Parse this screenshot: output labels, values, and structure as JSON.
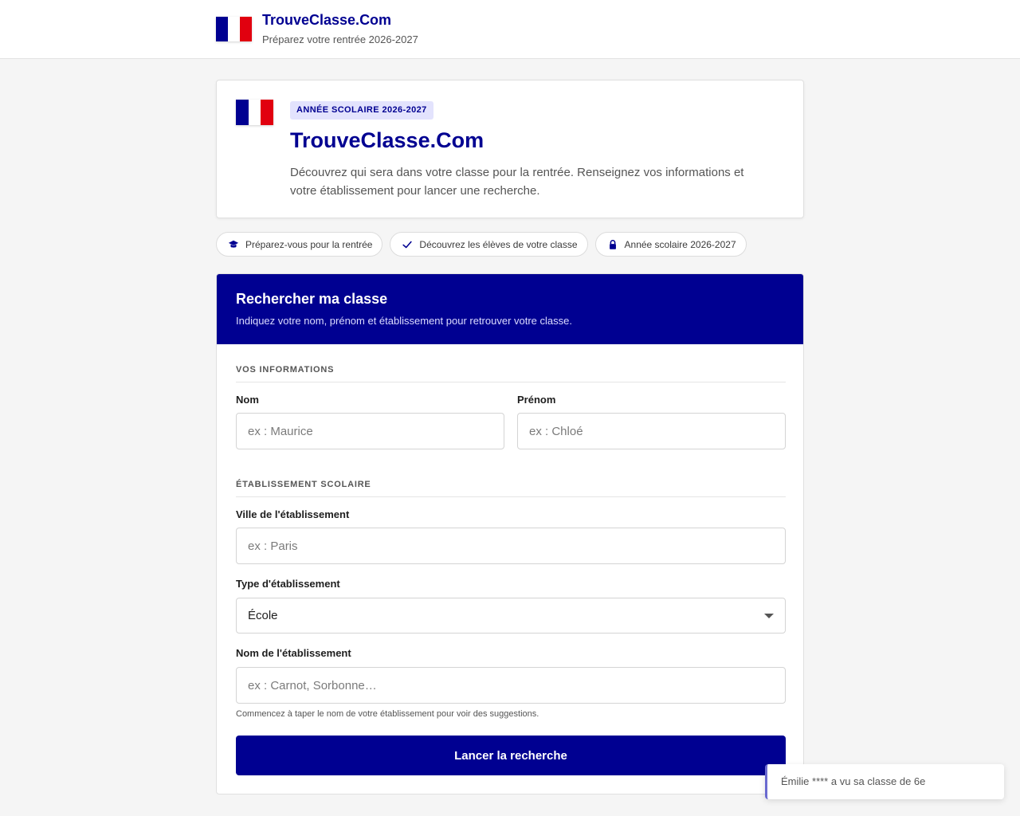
{
  "colors": {
    "primary": "#000091",
    "flag_blue": "#000091",
    "flag_red": "#e1000f",
    "badge_bg": "#e3e3fd"
  },
  "header": {
    "brand_name": "TrouveClasse.Com",
    "tagline": "Préparez votre rentrée 2026-2027"
  },
  "hero": {
    "badge": "ANNÉE SCOLAIRE 2026-2027",
    "title": "TrouveClasse.Com",
    "description": "Découvrez qui sera dans votre classe pour la rentrée. Renseignez vos informations et votre établissement pour lancer une recherche."
  },
  "pills": [
    {
      "icon": "graduation-cap-icon",
      "label": "Préparez-vous pour la rentrée"
    },
    {
      "icon": "check-icon",
      "label": "Découvrez les élèves de votre classe"
    },
    {
      "icon": "lock-icon",
      "label": "Année scolaire 2026-2027"
    }
  ],
  "search": {
    "title": "Rechercher ma classe",
    "subtitle": "Indiquez votre nom, prénom et établissement pour retrouver votre classe.",
    "section_info": "VOS INFORMATIONS",
    "nom": {
      "label": "Nom",
      "placeholder": "ex : Maurice",
      "value": ""
    },
    "prenom": {
      "label": "Prénom",
      "placeholder": "ex : Chloé",
      "value": ""
    },
    "section_school": "ÉTABLISSEMENT SCOLAIRE",
    "ville": {
      "label": "Ville de l'établissement",
      "placeholder": "ex : Paris",
      "value": ""
    },
    "type": {
      "label": "Type d'établissement",
      "selected": "École"
    },
    "etablissement": {
      "label": "Nom de l'établissement",
      "placeholder": "ex : Carnot, Sorbonne…",
      "value": ""
    },
    "hint": "Commencez à taper le nom de votre établissement pour voir des suggestions.",
    "submit_label": "Lancer la recherche"
  },
  "toast": {
    "text": "Émilie **** a vu sa classe de 6e"
  }
}
